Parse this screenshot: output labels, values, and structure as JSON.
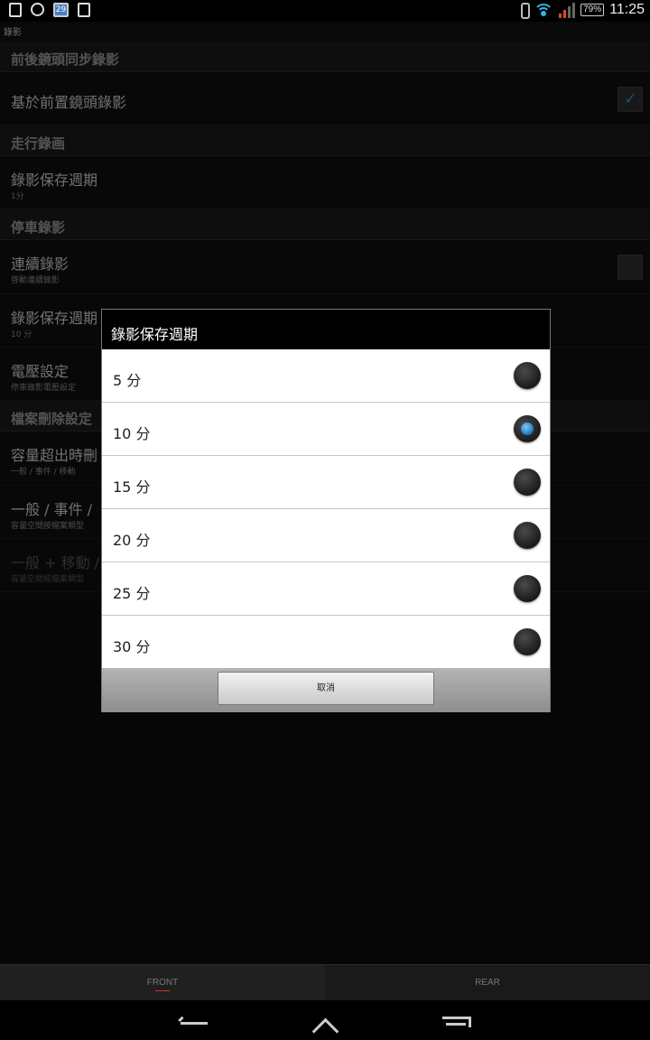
{
  "status_bar": {
    "icons_left": [
      "screenshot-icon",
      "gps-icon",
      "calendar-icon",
      "image-icon"
    ],
    "calendar_day": "29",
    "battery": "79%",
    "time": "11:25"
  },
  "app": {
    "title": "錄影"
  },
  "settings": {
    "cat1": "前後鏡頭同步錄影",
    "sync_front": {
      "title": "基於前置鏡頭錄影",
      "checked": true
    },
    "cat2": "走行錄画",
    "drive_period": {
      "title": "錄影保存週期",
      "summary": "1分"
    },
    "cat3": "停車錄影",
    "continuous": {
      "title": "連續錄影",
      "summary": "啓動連續錄影",
      "checked": false
    },
    "park_period": {
      "title": "錄影保存週期",
      "summary": "10 分"
    },
    "voltage": {
      "title": "電壓設定",
      "summary": "停車錄影電壓設定"
    },
    "cat4": "檔案刪除設定",
    "overflow": {
      "title": "容量超出時刪",
      "summary": "一般 / 事件 / 移動"
    },
    "normal_event": {
      "title": "一般 / 事件 /",
      "summary": "容量空間按檔案類型"
    },
    "normal_motion": {
      "title": "一般 + 移動 /",
      "summary": "容量空間按檔案類型"
    }
  },
  "dialog": {
    "title": "錄影保存週期",
    "options": [
      {
        "label": "5 分",
        "selected": false
      },
      {
        "label": "10 分",
        "selected": true
      },
      {
        "label": "15 分",
        "selected": false
      },
      {
        "label": "20 分",
        "selected": false
      },
      {
        "label": "25 分",
        "selected": false
      },
      {
        "label": "30 分",
        "selected": false
      }
    ],
    "cancel": "取消"
  },
  "tabs": {
    "front": "FRONT",
    "rear": "REAR"
  },
  "colors": {
    "accent": "#35b5e5",
    "radio_selected": "#1d77c4"
  }
}
